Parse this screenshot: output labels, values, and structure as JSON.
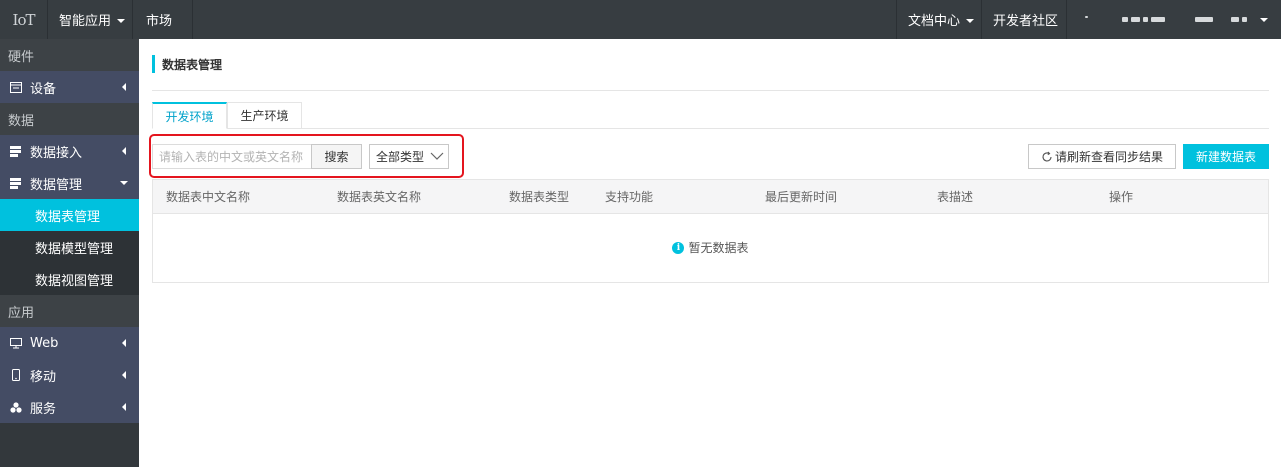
{
  "topbar": {
    "logo": "IoT",
    "app_menu": "智能应用",
    "market": "市场",
    "docs": "文档中心",
    "developer": "开发者社区"
  },
  "sidebar": {
    "groups": {
      "hardware": "硬件",
      "data": "数据",
      "app": "应用"
    },
    "items": {
      "device": "设备",
      "data_access": "数据接入",
      "data_manage": "数据管理",
      "web": "Web",
      "mobile": "移动",
      "service": "服务"
    },
    "subitems": {
      "table_manage": "数据表管理",
      "model_manage": "数据模型管理",
      "view_manage": "数据视图管理"
    }
  },
  "main": {
    "title": "数据表管理",
    "tabs": [
      "开发环境",
      "生产环境"
    ],
    "search": {
      "placeholder": "请输入表的中文或英文名称",
      "button": "搜索"
    },
    "type_select": "全部类型",
    "refresh_button": "请刷新查看同步结果",
    "new_button": "新建数据表",
    "table": {
      "columns": [
        "数据表中文名称",
        "数据表英文名称",
        "数据表类型",
        "支持功能",
        "最后更新时间",
        "表描述",
        "操作"
      ],
      "empty_text": "暂无数据表"
    }
  },
  "colors": {
    "accent": "#00c1de",
    "topbar": "#373d41",
    "sidebar": "#33383c",
    "highlight": "#e4151e"
  }
}
